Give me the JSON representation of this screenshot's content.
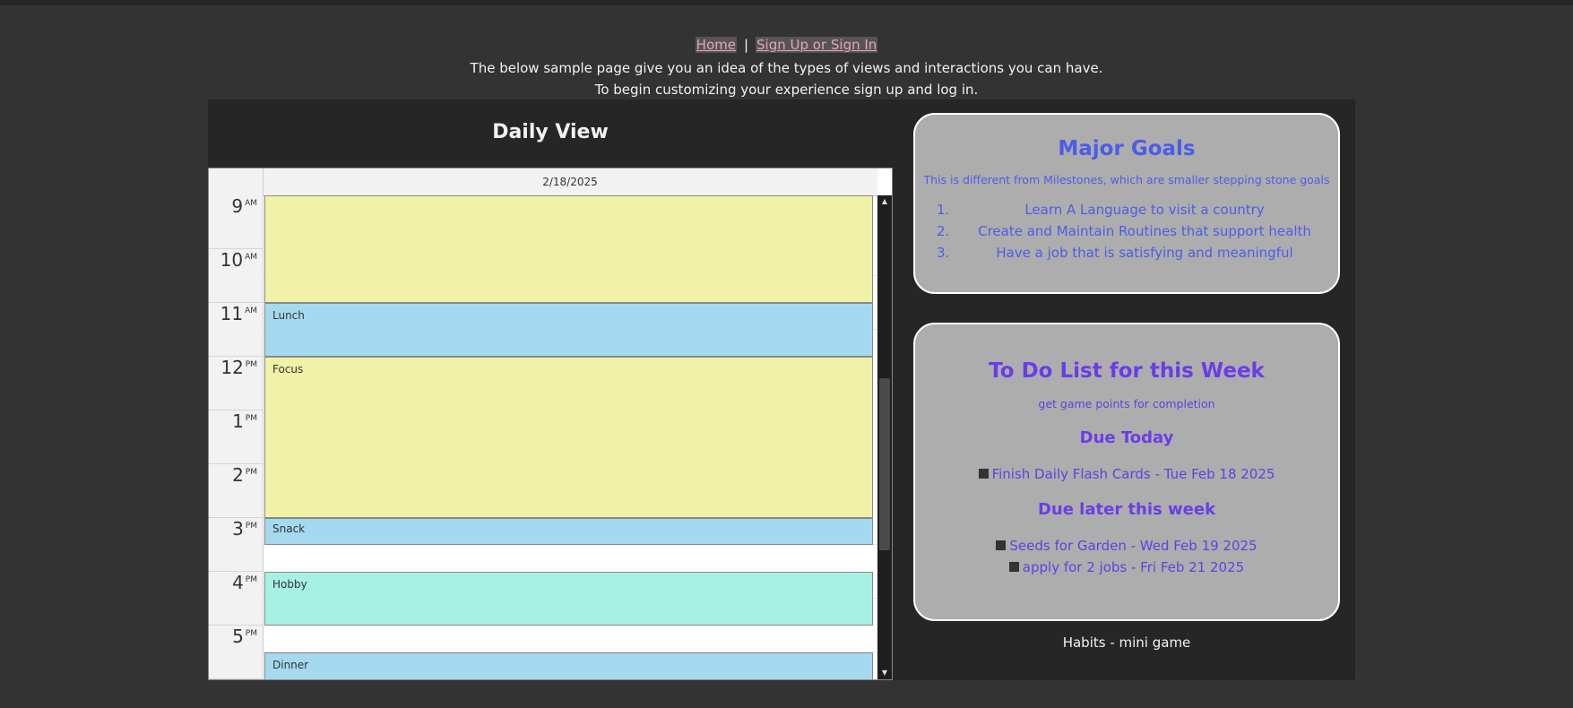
{
  "header": {
    "nav": {
      "home": "Home",
      "separator": "|",
      "signup": "Sign Up or Sign In"
    },
    "line1": "The below sample page give you an idea of the types of views and interactions you can have.",
    "line2": "To begin customizing your experience sign up and log in."
  },
  "daily": {
    "title": "Daily View",
    "date": "2/18/2025",
    "times": [
      {
        "hour": "9",
        "ampm": "AM"
      },
      {
        "hour": "10",
        "ampm": "AM"
      },
      {
        "hour": "11",
        "ampm": "AM"
      },
      {
        "hour": "12",
        "ampm": "PM"
      },
      {
        "hour": "1",
        "ampm": "PM"
      },
      {
        "hour": "2",
        "ampm": "PM"
      },
      {
        "hour": "3",
        "ampm": "PM"
      },
      {
        "hour": "4",
        "ampm": "PM"
      },
      {
        "hour": "5",
        "ampm": "PM"
      }
    ],
    "events": [
      {
        "label": "",
        "color": "#f1f1a8"
      },
      {
        "label": "Lunch",
        "color": "#a5d9ef"
      },
      {
        "label": "Focus",
        "color": "#f1f1a8"
      },
      {
        "label": "Snack",
        "color": "#a5d9ef"
      },
      {
        "label": "Hobby",
        "color": "#a7f1e4"
      },
      {
        "label": "Dinner",
        "color": "#a5d9ef"
      }
    ]
  },
  "goals": {
    "title": "Major Goals",
    "subtitle": "This is different from Milestones, which are smaller stepping stone goals",
    "items": [
      {
        "num": "1.",
        "text": "Learn A Language to visit a country"
      },
      {
        "num": "2.",
        "text": "Create and Maintain Routines that support health"
      },
      {
        "num": "3.",
        "text": "Have a job that is satisfying and meaningful"
      }
    ]
  },
  "todo": {
    "title": "To Do List for this Week",
    "subtitle": "get game points for completion",
    "due_today_heading": "Due Today",
    "due_today": [
      "Finish Daily Flash Cards - Tue Feb 18 2025"
    ],
    "due_later_heading": "Due later this week",
    "due_later": [
      "Seeds for Garden - Wed Feb 19 2025",
      "apply for 2 jobs - Fri Feb 21 2025"
    ]
  },
  "habits": {
    "label": "Habits - mini game"
  },
  "colors": {
    "background": "#333333",
    "panel": "#adadad",
    "goals_text": "#4c5de8",
    "todo_text": "#6a3de8",
    "link": "#e7a1c4"
  }
}
